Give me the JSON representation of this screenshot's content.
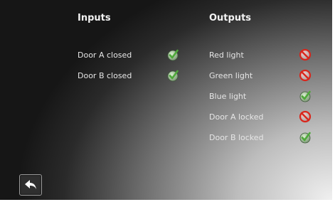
{
  "inputs": {
    "heading": "Inputs",
    "items": [
      {
        "label": "Door A closed",
        "status": "ok"
      },
      {
        "label": "Door B closed",
        "status": "ok"
      }
    ]
  },
  "outputs": {
    "heading": "Outputs",
    "items": [
      {
        "label": "Red light",
        "status": "off"
      },
      {
        "label": "Green light",
        "status": "off"
      },
      {
        "label": "Blue light",
        "status": "ok"
      },
      {
        "label": "Door A locked",
        "status": "off"
      },
      {
        "label": "Door B locked",
        "status": "ok"
      }
    ]
  },
  "icons": {
    "ok": "check-icon",
    "off": "no-icon",
    "back": "back-arrow-icon"
  },
  "colors": {
    "ok_green": "#4ea83a",
    "off_red": "#d9261c"
  }
}
